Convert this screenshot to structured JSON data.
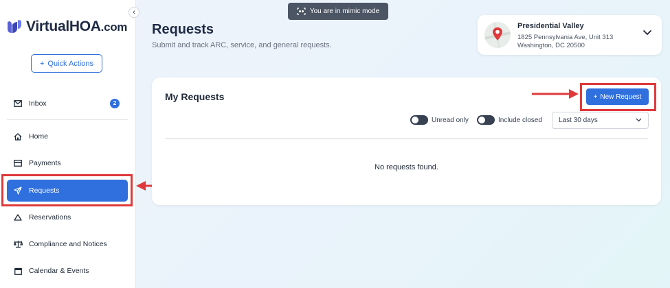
{
  "brand": {
    "name_main": "VirtualHOA",
    "name_suffix": ".com"
  },
  "sidebar": {
    "quick_actions_label": "Quick Actions",
    "inbox": {
      "label": "Inbox",
      "count": "2"
    },
    "items": [
      {
        "label": "Home",
        "icon": "home-icon"
      },
      {
        "label": "Payments",
        "icon": "card-icon"
      },
      {
        "label": "Requests",
        "icon": "send-icon",
        "active": true
      },
      {
        "label": "Reservations",
        "icon": "tent-icon"
      },
      {
        "label": "Compliance and Notices",
        "icon": "scale-icon"
      },
      {
        "label": "Calendar & Events",
        "icon": "calendar-icon"
      }
    ]
  },
  "banner": {
    "text": "You are in mimic mode"
  },
  "header": {
    "title": "Requests",
    "subtitle": "Submit and track ARC, service, and general requests."
  },
  "property": {
    "name": "Presidential Valley",
    "address_line1": "1825 Pennsylvania Ave, Unit 313",
    "address_line2": "Washington, DC 20500"
  },
  "requests_panel": {
    "title": "My Requests",
    "new_request_label": "New Request",
    "unread_only_label": "Unread only",
    "include_closed_label": "Include closed",
    "date_filter_value": "Last 30 days",
    "empty_message": "No requests found."
  },
  "colors": {
    "accent": "#2f6fde",
    "highlight": "#e0393b"
  }
}
